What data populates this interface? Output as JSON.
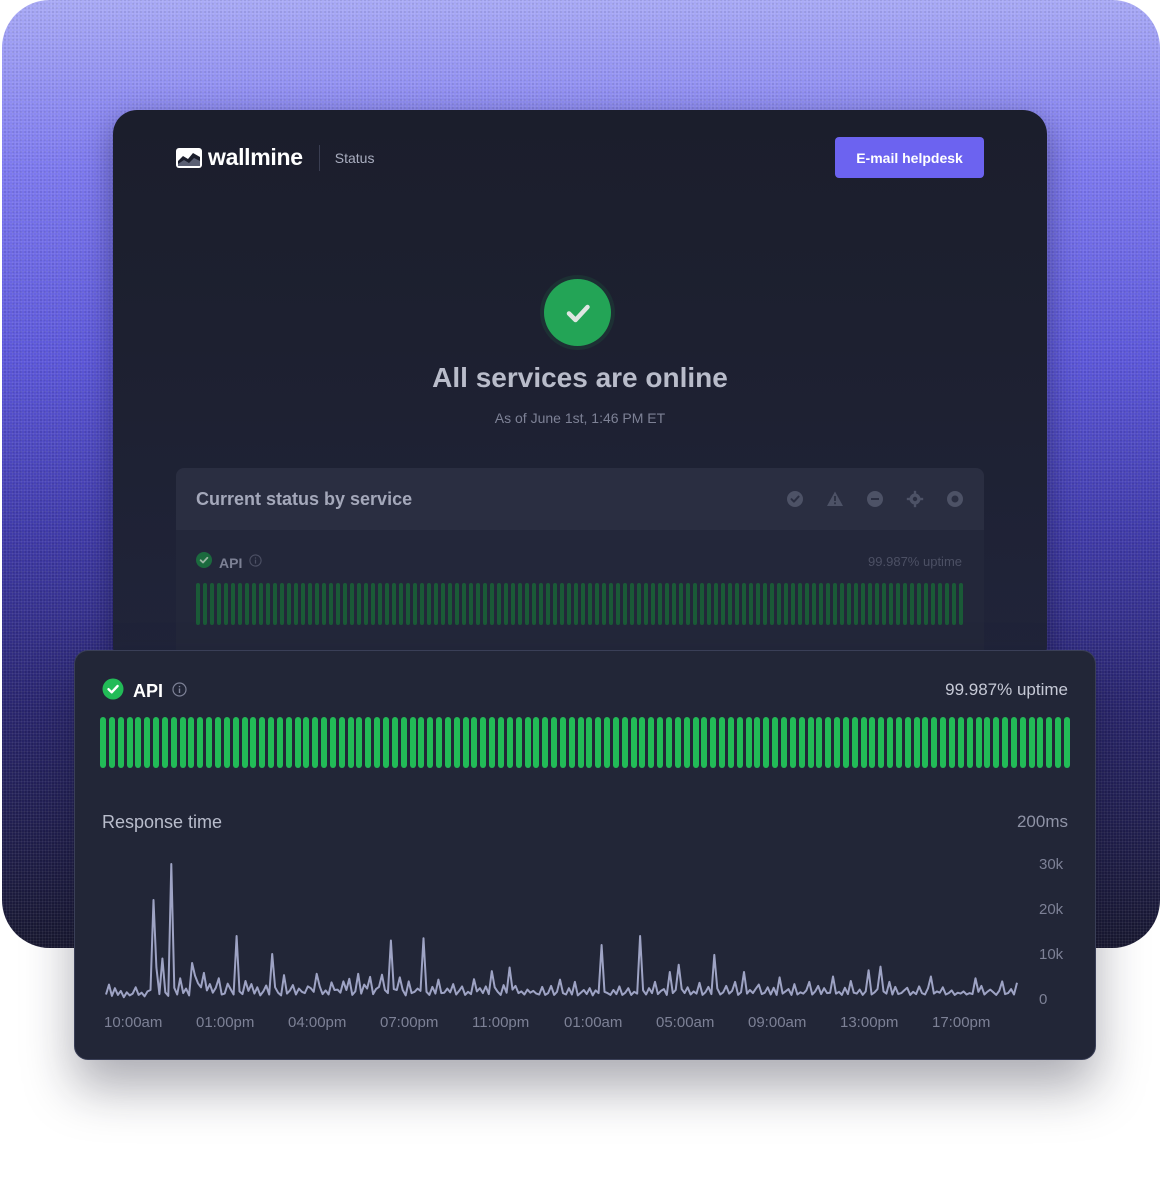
{
  "header": {
    "brand": "wallmine",
    "section": "Status",
    "helpdesk_button": "E-mail helpdesk"
  },
  "hero": {
    "title": "All services are online",
    "subtitle": "As of June 1st, 1:46 PM ET"
  },
  "status_card": {
    "title": "Current status by service",
    "legend_icons": [
      "operational-icon",
      "warning-icon",
      "outage-icon",
      "maintenance-icon",
      "unknown-icon"
    ],
    "service": {
      "name": "API",
      "uptime": "99.987% uptime",
      "bar_count": 110,
      "bar_color": "#1a5a37"
    }
  },
  "detail_card": {
    "service_name": "API",
    "uptime": "99.987% uptime",
    "bar_count": 110,
    "bar_color": "#22bb57",
    "response_time_label": "Response time",
    "response_time_value": "200ms"
  },
  "colors": {
    "accent": "#6c63f0",
    "success": "#23a456"
  },
  "chart_data": {
    "type": "line",
    "title": "Response time",
    "x_tick_labels": [
      "10:00am",
      "01:00pm",
      "04:00pm",
      "07:00pm",
      "11:00pm",
      "01:00am",
      "05:00am",
      "09:00am",
      "13:00pm",
      "17:00pm"
    ],
    "y_tick_labels": [
      "30k",
      "20k",
      "10k",
      "0"
    ],
    "ylim": [
      0,
      30000
    ],
    "grid": false,
    "values": [
      1000,
      3200,
      700,
      2400,
      900,
      1800,
      400,
      1500,
      800,
      1200,
      2600,
      900,
      1400,
      600,
      1700,
      2000,
      22000,
      7000,
      1100,
      9000,
      1500,
      700,
      30000,
      2500,
      1000,
      4600,
      1300,
      2300,
      800,
      8000,
      5200,
      3500,
      2600,
      5800,
      1900,
      3300,
      1400,
      2500,
      4600,
      1000,
      1200,
      3400,
      2200,
      1000,
      14000,
      1700,
      1100,
      4000,
      1800,
      3300,
      1200,
      2600,
      800,
      1700,
      3000,
      1000,
      10000,
      2600,
      1400,
      800,
      5300,
      1200,
      1900,
      3100,
      1000,
      2300,
      1600,
      1300,
      2800,
      2400,
      1600,
      5600,
      2800,
      1100,
      1900,
      1000,
      3700,
      2000,
      2100,
      1400,
      3900,
      2000,
      4500,
      900,
      1700,
      5600,
      1200,
      3200,
      2300,
      4900,
      1100,
      2200,
      2700,
      5400,
      2000,
      1300,
      13000,
      2200,
      2000,
      4800,
      2000,
      800,
      3900,
      1300,
      1600,
      2300,
      1800,
      13500,
      1600,
      900,
      2700,
      1200,
      4300,
      1300,
      1400,
      2300,
      1500,
      3300,
      1000,
      1800,
      2800,
      900,
      1600,
      1100,
      4400,
      1700,
      2400,
      1300,
      2800,
      1100,
      6200,
      2600,
      1600,
      900,
      3100,
      1400,
      7000,
      2100,
      2900,
      1300,
      1700,
      1000,
      2100,
      1400,
      1800,
      1200,
      1000,
      2700,
      900,
      1300,
      2900,
      900,
      1600,
      4300,
      1300,
      1000,
      2400,
      1000,
      3800,
      800,
      1400,
      2000,
      1100,
      2400,
      800,
      1900,
      1300,
      12000,
      1600,
      1300,
      900,
      2000,
      1100,
      2800,
      900,
      1400,
      2400,
      900,
      1600,
      1200,
      14000,
      1900,
      1000,
      2400,
      1300,
      3800,
      1100,
      1800,
      2200,
      900,
      6000,
      1300,
      2000,
      7600,
      2200,
      1300,
      2600,
      1000,
      1700,
      1200,
      3600,
      900,
      1500,
      2700,
      1100,
      9800,
      2300,
      1000,
      1500,
      2900,
      1200,
      1800,
      3800,
      900,
      1500,
      6000,
      1200,
      2000,
      1300,
      2300,
      3200,
      1100,
      1400,
      2600,
      1000,
      2500,
      900,
      4800,
      1200,
      1700,
      2200,
      900,
      3300,
      1000,
      1500,
      1200,
      1900,
      3800,
      1000,
      1700,
      2900,
      1100,
      2400,
      1300,
      1400,
      5000,
      1200,
      1600,
      900,
      2500,
      1100,
      4000,
      1400,
      1200,
      2100,
      900,
      1700,
      6400,
      1000,
      1500,
      2200,
      7200,
      1700,
      1200,
      3800,
      1000,
      2700,
      1100,
      1300,
      1900,
      2500,
      900,
      1600,
      1100,
      2800,
      1300,
      1000,
      2400,
      5000,
      1200,
      1700,
      1400,
      2600,
      1000,
      1300,
      1900,
      900,
      1400,
      1200,
      1700,
      1000,
      1300,
      1100,
      4600,
      1600,
      2900,
      1000,
      1600,
      2100,
      1500,
      900,
      1800,
      3900,
      1100,
      1300,
      2200,
      1000,
      3600
    ]
  }
}
